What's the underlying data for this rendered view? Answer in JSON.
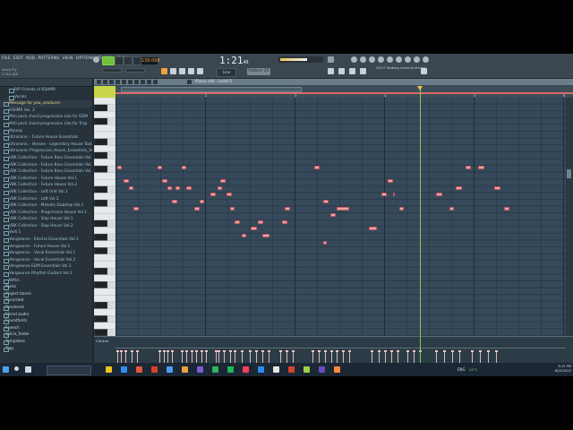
{
  "menu": [
    "FILE",
    "EDIT",
    "ADD",
    "PATTERNS",
    "VIEW",
    "OPTIONS",
    "TOOLS",
    "HELP"
  ],
  "hint": {
    "line1": "Voice Fly",
    "line2": "3 %/s N/S"
  },
  "transport": {
    "time": "1:21",
    "time_small": "40",
    "bpm": "130.000",
    "snap": "Line",
    "pattern": "Pattern 25"
  },
  "news": "20/17 Making chord and bass",
  "piano_roll": {
    "title": "Piano roll - Lead 5",
    "ruler_numbers": [
      "2",
      "3",
      "4",
      "5",
      "6",
      "7",
      "8"
    ],
    "control_label": "Control",
    "accent": "#7ad14a",
    "note_color": "#f2a0a2"
  },
  "notes": [
    {
      "t": 0.0,
      "p": 0,
      "w": 0.9
    },
    {
      "t": 0.2,
      "p": 2,
      "w": 0.9
    },
    {
      "t": 0.35,
      "p": 3,
      "w": 0.9
    },
    {
      "t": 0.5,
      "p": 6,
      "w": 1.0
    },
    {
      "t": 1.25,
      "p": 0,
      "w": 0.9
    },
    {
      "t": 1.4,
      "p": 2,
      "w": 0.9
    },
    {
      "t": 1.55,
      "p": 3,
      "w": 0.9
    },
    {
      "t": 1.7,
      "p": 5,
      "w": 0.9
    },
    {
      "t": 2.0,
      "p": 0,
      "w": 0.9
    },
    {
      "t": 1.8,
      "p": 3,
      "w": 0.9
    },
    {
      "t": 2.15,
      "p": 3,
      "w": 0.9
    },
    {
      "t": 2.4,
      "p": 6,
      "w": 0.9
    },
    {
      "t": 2.55,
      "p": 5,
      "w": 0.9
    },
    {
      "t": 2.9,
      "p": 4,
      "w": 0.9
    },
    {
      "t": 3.1,
      "p": 3,
      "w": 0.9
    },
    {
      "t": 3.2,
      "p": 2,
      "w": 0.9
    },
    {
      "t": 3.4,
      "p": 4,
      "w": 0.9
    },
    {
      "t": 3.5,
      "p": 6,
      "w": 0.9
    },
    {
      "t": 3.65,
      "p": 8,
      "w": 0.9
    },
    {
      "t": 3.85,
      "p": 10,
      "w": 0.9
    },
    {
      "t": 4.15,
      "p": 9,
      "w": 1.1
    },
    {
      "t": 4.35,
      "p": 8,
      "w": 1.0
    },
    {
      "t": 4.5,
      "p": 10,
      "w": 1.3
    },
    {
      "t": 5.1,
      "p": 8,
      "w": 1.0
    },
    {
      "t": 5.2,
      "p": 6,
      "w": 1.0
    },
    {
      "t": 6.1,
      "p": 0,
      "w": 1.1
    },
    {
      "t": 6.4,
      "p": 5,
      "w": 1.0
    },
    {
      "t": 6.6,
      "p": 7,
      "w": 1.0
    },
    {
      "t": 6.8,
      "p": 6,
      "w": 2.4
    },
    {
      "t": 6.4,
      "p": 11,
      "w": 0.6
    },
    {
      "t": 7.8,
      "p": 9,
      "w": 1.6
    },
    {
      "t": 8.2,
      "p": 4,
      "w": 1.0
    },
    {
      "t": 8.4,
      "p": 2,
      "w": 0.9
    },
    {
      "t": 8.55,
      "p": 4,
      "w": 0.4
    },
    {
      "t": 8.75,
      "p": 6,
      "w": 0.9
    },
    {
      "t": 9.9,
      "p": 4,
      "w": 1.1
    },
    {
      "t": 10.3,
      "p": 6,
      "w": 0.9
    },
    {
      "t": 10.5,
      "p": 3,
      "w": 1.1
    },
    {
      "t": 10.8,
      "p": 0,
      "w": 1.1
    },
    {
      "t": 11.2,
      "p": 0,
      "w": 1.1
    },
    {
      "t": 11.7,
      "p": 3,
      "w": 1.1
    },
    {
      "t": 12.0,
      "p": 6,
      "w": 1.0
    }
  ],
  "browser": {
    "items": [
      {
        "label": "RIP Friends of KSHMR",
        "type": "sub"
      },
      {
        "label": "Vocals",
        "type": "sub"
      },
      {
        "label": "Message for you, producer",
        "type": "sel"
      },
      {
        "label": "KSHMR Vol. 3",
        "type": "norm"
      },
      {
        "label": "Midi pack chord progression Lite for EDM",
        "type": "norm"
      },
      {
        "label": "Midi pack chord progression Lite for Trap",
        "type": "norm"
      },
      {
        "label": "Mylesp",
        "type": "norm"
      },
      {
        "label": "Ultrasonic - Future House Essentials",
        "type": "norm"
      },
      {
        "label": "Ultrasonic - Heroes - Legendary House Toolkit",
        "type": "norm"
      },
      {
        "label": "Ultrasonic-Progressive_House_Essentials_Vol.1",
        "type": "norm"
      },
      {
        "label": "VBK Collection - Future Bass Essentials Vol.1",
        "type": "norm"
      },
      {
        "label": "VBK Collection - Future Bass Essentials Vol.2",
        "type": "norm"
      },
      {
        "label": "VBK Collection - Future Bass Essentials Vol.3",
        "type": "norm"
      },
      {
        "label": "VBK Collection - Future House Vol.1",
        "type": "norm"
      },
      {
        "label": "VBK Collection - Future House Vol.2",
        "type": "norm"
      },
      {
        "label": "VBK Collection - Left Unit Vol.1",
        "type": "norm"
      },
      {
        "label": "VBK Collection - Left Vol.2",
        "type": "norm"
      },
      {
        "label": "VBK Collection - Melodic Dubstep Vol.1",
        "type": "norm"
      },
      {
        "label": "VBK Collection - Progressive House Vol.1",
        "type": "norm"
      },
      {
        "label": "VBK Collection - Slap House Vol.1",
        "type": "norm"
      },
      {
        "label": "VBK Collection - Slap House Vol.2",
        "type": "norm"
      },
      {
        "label": "Vedi 1",
        "type": "norm"
      },
      {
        "label": "Vengeance - Electro Essentials Vol.1",
        "type": "norm"
      },
      {
        "label": "Vengeance - Future House Vol.1",
        "type": "norm"
      },
      {
        "label": "Vengeance - Vocal Essentials Vol.1",
        "type": "norm"
      },
      {
        "label": "Vengeance - Vocal Essentials Vol.2",
        "type": "norm"
      },
      {
        "label": "Vengeance EDM Essentials Vol.1",
        "type": "norm"
      },
      {
        "label": "Vengeance Rhythm Guitars Vol.1",
        "type": "norm"
      },
      {
        "label": "WAVs",
        "type": "norm"
      },
      {
        "label": "Packs",
        "type": "top"
      },
      {
        "label": "Project bones",
        "type": "top"
      },
      {
        "label": "Recorded",
        "type": "top"
      },
      {
        "label": "Rendered",
        "type": "top"
      },
      {
        "label": "Sliced audio",
        "type": "top"
      },
      {
        "label": "Soundfonts",
        "type": "top"
      },
      {
        "label": "Speech",
        "type": "top"
      },
      {
        "label": "splice_folder",
        "type": "top"
      },
      {
        "label": "Templates",
        "type": "top"
      },
      {
        "label": "Trap",
        "type": "top"
      }
    ]
  },
  "control_bars": [
    {
      "t": 0.0,
      "h": 0.8
    },
    {
      "t": 0.1,
      "h": 0.8
    },
    {
      "t": 0.25,
      "h": 0.8
    },
    {
      "t": 0.45,
      "h": 0.8
    },
    {
      "t": 0.6,
      "h": 0.8
    },
    {
      "t": 1.3,
      "h": 0.8
    },
    {
      "t": 1.45,
      "h": 0.8
    },
    {
      "t": 1.55,
      "h": 0.8
    },
    {
      "t": 1.7,
      "h": 0.8
    },
    {
      "t": 2.0,
      "h": 0.8
    },
    {
      "t": 2.15,
      "h": 0.8
    },
    {
      "t": 2.3,
      "h": 0.8
    },
    {
      "t": 2.45,
      "h": 0.8
    },
    {
      "t": 2.6,
      "h": 0.8
    },
    {
      "t": 2.75,
      "h": 0.8
    },
    {
      "t": 3.05,
      "h": 0.8
    },
    {
      "t": 3.15,
      "h": 0.8
    },
    {
      "t": 3.3,
      "h": 0.8
    },
    {
      "t": 3.5,
      "h": 0.8
    },
    {
      "t": 3.65,
      "h": 0.8
    },
    {
      "t": 3.85,
      "h": 0.8
    },
    {
      "t": 4.1,
      "h": 0.8
    },
    {
      "t": 4.3,
      "h": 0.8
    },
    {
      "t": 4.5,
      "h": 0.8
    },
    {
      "t": 4.7,
      "h": 0.8
    },
    {
      "t": 5.05,
      "h": 0.8
    },
    {
      "t": 5.25,
      "h": 0.8
    },
    {
      "t": 5.45,
      "h": 0.8
    },
    {
      "t": 6.05,
      "h": 0.8
    },
    {
      "t": 6.25,
      "h": 0.8
    },
    {
      "t": 6.45,
      "h": 0.8
    },
    {
      "t": 6.65,
      "h": 0.8
    },
    {
      "t": 6.8,
      "h": 0.8
    },
    {
      "t": 7.0,
      "h": 0.8
    },
    {
      "t": 7.2,
      "h": 0.8
    },
    {
      "t": 7.9,
      "h": 0.8
    },
    {
      "t": 8.1,
      "h": 0.8
    },
    {
      "t": 8.3,
      "h": 0.8
    },
    {
      "t": 8.5,
      "h": 0.8
    },
    {
      "t": 8.7,
      "h": 0.8
    },
    {
      "t": 9.0,
      "h": 0.8
    },
    {
      "t": 9.2,
      "h": 0.8
    },
    {
      "t": 9.4,
      "h": 0.8
    },
    {
      "t": 9.9,
      "h": 0.8
    },
    {
      "t": 10.15,
      "h": 0.8
    },
    {
      "t": 10.4,
      "h": 0.8
    },
    {
      "t": 10.6,
      "h": 0.8
    },
    {
      "t": 11.0,
      "h": 0.8
    },
    {
      "t": 11.25,
      "h": 0.8
    },
    {
      "t": 11.5,
      "h": 0.8
    },
    {
      "t": 11.75,
      "h": 0.8
    }
  ],
  "taskbar": {
    "apps": [
      "#f0c419",
      "#2b8ef0",
      "#e05a3a",
      "#d4432b",
      "#4d9ef0",
      "#e6a23c",
      "#7e5bd3",
      "#30b45a",
      "#1db954",
      "#ff3b5c",
      "#2b8ef0",
      "#e5e5e5",
      "#d4432b",
      "#9fd14a",
      "#6a4cc2",
      "#ff8a3c"
    ],
    "weather": "22°C",
    "tray_label": "ENG",
    "time": "8:15 PM",
    "date": "8/24/2022"
  }
}
